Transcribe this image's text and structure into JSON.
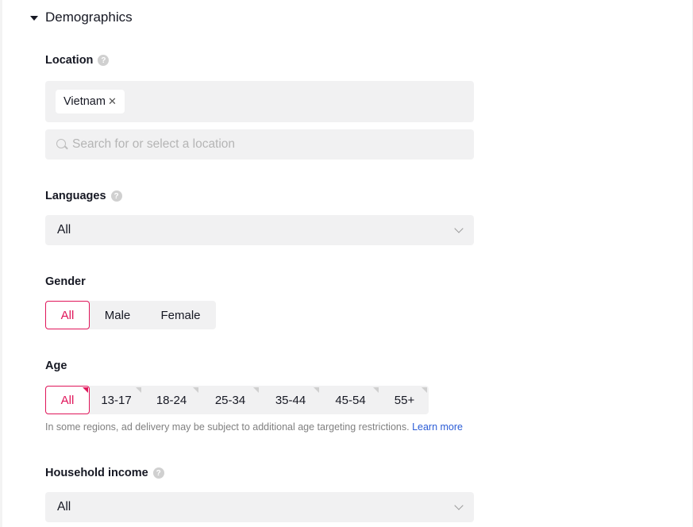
{
  "section": {
    "title": "Demographics",
    "expanded": true
  },
  "location": {
    "label": "Location",
    "help_icon": "question-circle-icon",
    "selected_tags": [
      {
        "label": "Vietnam",
        "remove_icon": "close-icon"
      }
    ],
    "search_placeholder": "Search for or select a location",
    "search_value": ""
  },
  "languages": {
    "label": "Languages",
    "help_icon": "question-circle-icon",
    "selected": "All"
  },
  "gender": {
    "label": "Gender",
    "options": [
      "All",
      "Male",
      "Female"
    ],
    "selected": "All"
  },
  "age": {
    "label": "Age",
    "options": [
      "All",
      "13-17",
      "18-24",
      "25-34",
      "35-44",
      "45-54",
      "55+"
    ],
    "selected": "All",
    "note": "In some regions, ad delivery may be subject to additional age targeting restrictions.",
    "learn_more": "Learn more"
  },
  "household_income": {
    "label": "Household income",
    "help_icon": "question-circle-icon",
    "selected": "All"
  },
  "colors": {
    "accent": "#e0155a",
    "field_bg": "#f1f1f2",
    "link": "#2b5cd6"
  }
}
